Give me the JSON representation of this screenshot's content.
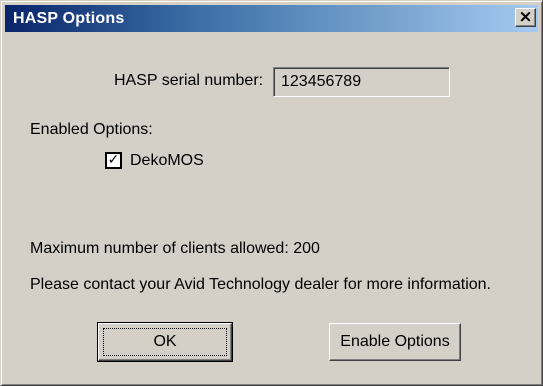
{
  "window": {
    "title": "HASP Options",
    "close_glyph": "×"
  },
  "serial": {
    "label": "HASP serial number:",
    "value": "123456789"
  },
  "options": {
    "heading": "Enabled Options:",
    "items": [
      {
        "label": "DekoMOS",
        "checked": true,
        "check_glyph": "✓"
      }
    ]
  },
  "info": {
    "max_clients": "Maximum number of clients allowed: 200",
    "contact": "Please contact your Avid Technology dealer for more information."
  },
  "buttons": {
    "ok": "OK",
    "enable": "Enable Options"
  }
}
